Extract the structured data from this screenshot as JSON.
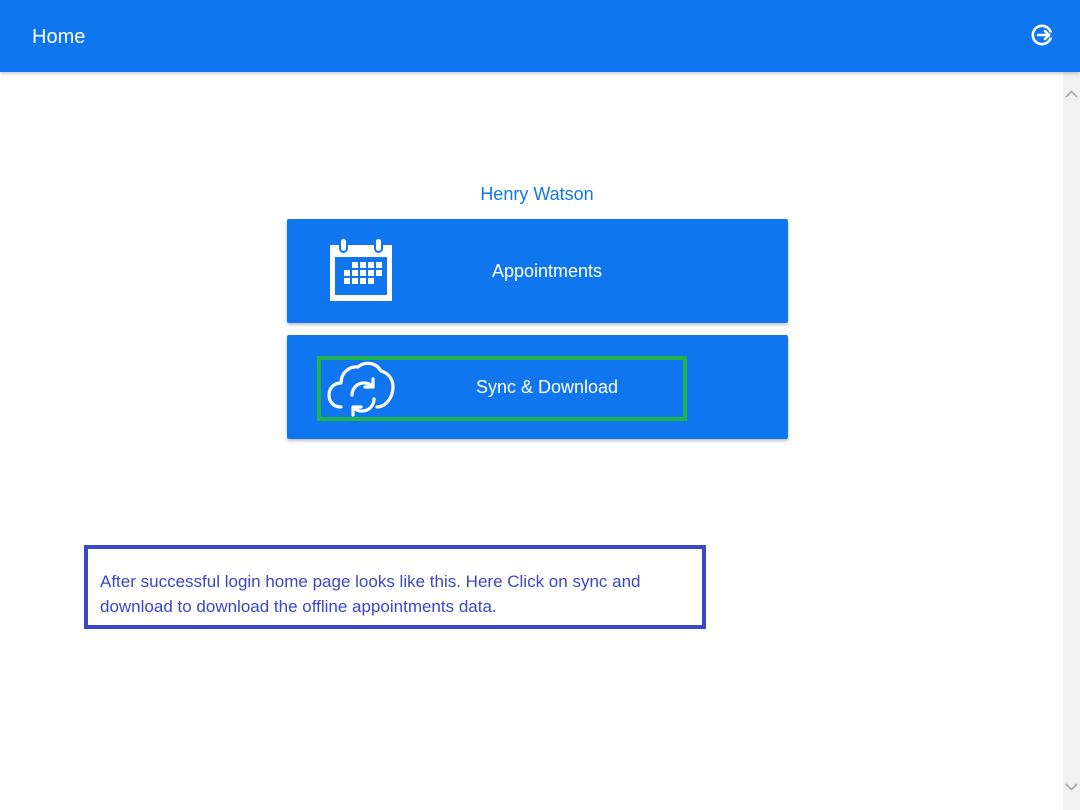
{
  "header": {
    "title": "Home",
    "logout_icon": "logout-icon"
  },
  "user": {
    "name": "Henry Watson"
  },
  "tiles": [
    {
      "label": "Appointments",
      "icon": "calendar-icon"
    },
    {
      "label": "Sync & Download",
      "icon": "cloud-sync-icon"
    }
  ],
  "annotation": {
    "text": "After successful login home page looks like this. Here Click on sync and download to download the offline appointments data."
  },
  "colors": {
    "primary": "#0f76f0",
    "highlight": "#22b14c",
    "note": "#3b47c8"
  }
}
